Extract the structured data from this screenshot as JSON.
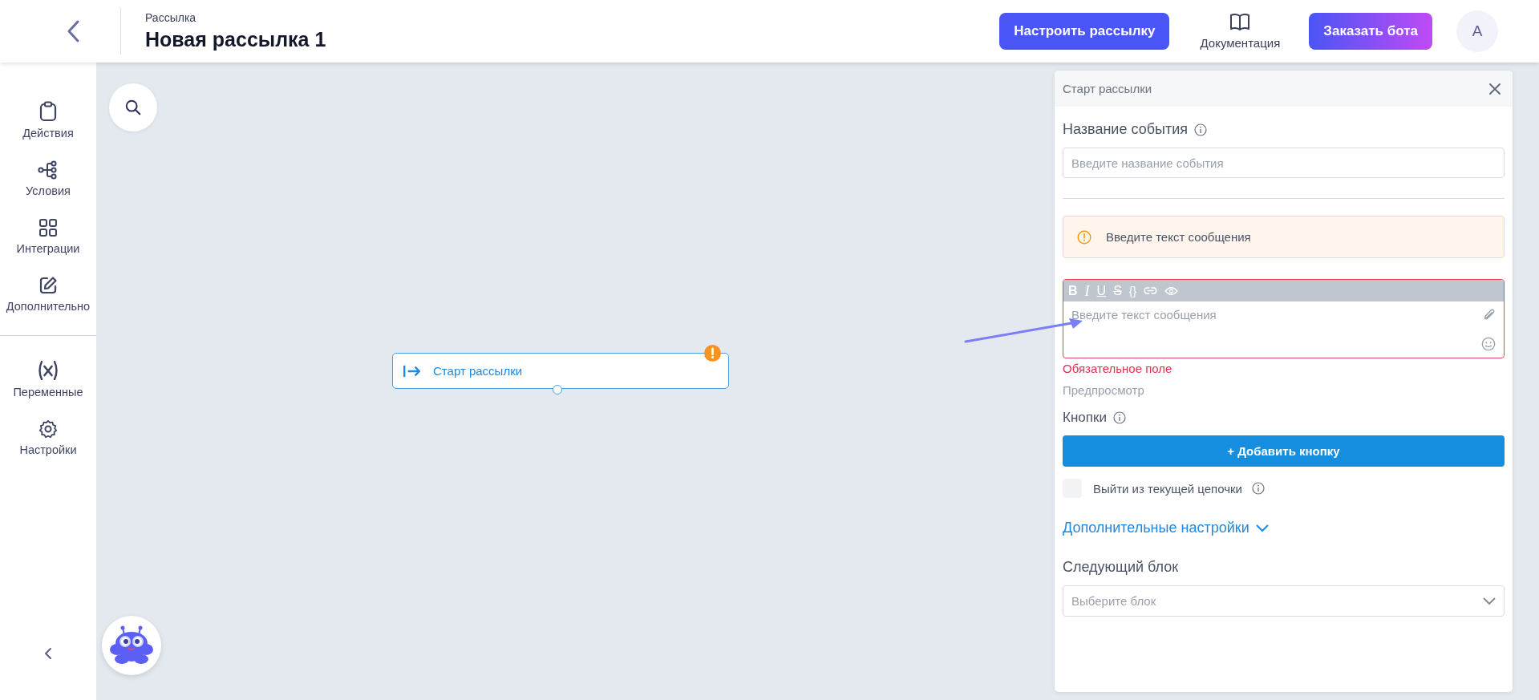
{
  "header": {
    "breadcrumb": "Рассылка",
    "title": "Новая рассылка 1",
    "configure_button": "Настроить рассылку",
    "docs_link": "Документация",
    "order_button": "Заказать бота",
    "avatar": "A"
  },
  "sidebar": {
    "groups": [
      [
        {
          "label": "Действия"
        },
        {
          "label": "Условия"
        },
        {
          "label": "Интеграции"
        },
        {
          "label": "Дополнительно"
        }
      ],
      [
        {
          "label": "Переменные"
        },
        {
          "label": "Настройки"
        }
      ]
    ]
  },
  "canvas": {
    "node": {
      "title": "Старт рассылки",
      "warning": true
    }
  },
  "panel": {
    "title": "Старт рассылки",
    "event_name": {
      "label": "Название события",
      "placeholder": "Введите название события"
    },
    "alert": {
      "text": "Введите текст сообщения"
    },
    "editor": {
      "toolbar": [
        "B",
        "I",
        "U",
        "S",
        "{}"
      ],
      "placeholder": "Введите текст сообщения",
      "invalid": true,
      "error": "Обязательное поле",
      "preview": "Предпросмотр"
    },
    "buttons": {
      "label": "Кнопки",
      "add_button": "+ Добавить кнопку"
    },
    "exit_chain": {
      "label": "Выйти из текущей цепочки",
      "checked": false
    },
    "advanced": {
      "label": "Дополнительные настройки",
      "expanded": false
    },
    "next_block": {
      "label": "Следующий блок",
      "placeholder": "Выберите блок"
    }
  }
}
